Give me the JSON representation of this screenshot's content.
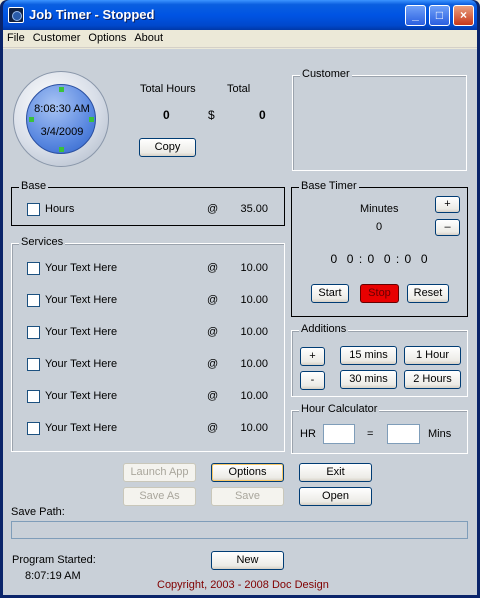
{
  "window": {
    "title": "Job Timer - Stopped",
    "min": "_",
    "max": "□",
    "close": "×"
  },
  "menu": [
    "File",
    "Customer",
    "Options",
    "About"
  ],
  "clock": {
    "time": "8:08:30 AM",
    "date": "3/4/2009"
  },
  "totals": {
    "hours_label": "Total Hours",
    "total_label": "Total",
    "hours_value": "0",
    "currency": "$",
    "total_value": "0",
    "copy_button": "Copy"
  },
  "customer": {
    "legend": "Customer"
  },
  "base": {
    "legend": "Base",
    "item": {
      "label": "Hours",
      "at": "@",
      "rate": "35.00"
    }
  },
  "services": {
    "legend": "Services",
    "items": [
      {
        "label": "Your Text Here",
        "at": "@",
        "rate": "10.00"
      },
      {
        "label": "Your Text Here",
        "at": "@",
        "rate": "10.00"
      },
      {
        "label": "Your Text Here",
        "at": "@",
        "rate": "10.00"
      },
      {
        "label": "Your Text Here",
        "at": "@",
        "rate": "10.00"
      },
      {
        "label": "Your Text Here",
        "at": "@",
        "rate": "10.00"
      },
      {
        "label": "Your Text Here",
        "at": "@",
        "rate": "10.00"
      }
    ]
  },
  "base_timer": {
    "legend": "Base Timer",
    "minutes_label": "Minutes",
    "minutes_value": "0",
    "plus": "+",
    "minus": "–",
    "display": "0  0 : 0  0 : 0  0",
    "start": "Start",
    "stop": "Stop",
    "reset": "Reset"
  },
  "additions": {
    "legend": "Additions",
    "plus": "+",
    "minus": "-",
    "b15": "15 mins",
    "b1h": "1 Hour",
    "b30": "30 mins",
    "b2h": "2 Hours"
  },
  "hour_calc": {
    "legend": "Hour Calculator",
    "hr_label": "HR",
    "equals": "=",
    "mins_label": "Mins"
  },
  "actions": {
    "launch_app": "Launch App",
    "options": "Options",
    "exit": "Exit",
    "save_as": "Save As",
    "save": "Save",
    "open": "Open"
  },
  "save_path": {
    "label": "Save Path:"
  },
  "footer": {
    "started_label": "Program Started:",
    "started_time": "8:07:19 AM",
    "new_button": "New",
    "copyright": "Copyright, 2003 - 2008  Doc Design"
  },
  "colors": {
    "titlebar": "#0054E3",
    "stop_button": "#E80000",
    "copyright": "#800000",
    "background": "#C9D0D8"
  }
}
